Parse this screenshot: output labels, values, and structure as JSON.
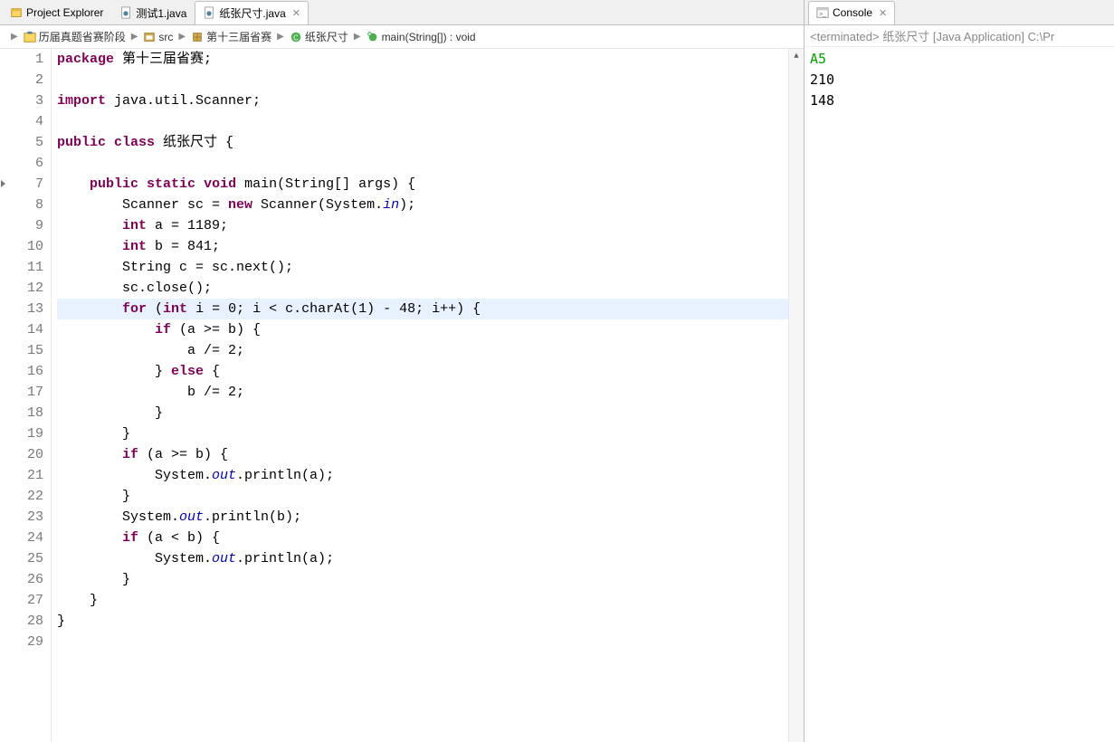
{
  "tabs": {
    "project_explorer": "Project Explorer",
    "file1": "测试1.java",
    "file2": "纸张尺寸.java"
  },
  "breadcrumb": {
    "item1": "历届真题省赛阶段",
    "item2": "src",
    "item3": "第十三届省赛",
    "item4": "纸张尺寸",
    "item5": "main(String[]) : void"
  },
  "code": {
    "lines": [
      {
        "n": "1",
        "seg": [
          {
            "t": "package",
            "c": "kw"
          },
          {
            "t": " 第十三届省赛;",
            "c": "plain"
          }
        ]
      },
      {
        "n": "2",
        "seg": []
      },
      {
        "n": "3",
        "seg": [
          {
            "t": "import",
            "c": "kw"
          },
          {
            "t": " java.util.Scanner;",
            "c": "plain"
          }
        ]
      },
      {
        "n": "4",
        "seg": []
      },
      {
        "n": "5",
        "seg": [
          {
            "t": "public",
            "c": "kw"
          },
          {
            "t": " ",
            "c": "plain"
          },
          {
            "t": "class",
            "c": "kw"
          },
          {
            "t": " 纸张尺寸 {",
            "c": "plain"
          }
        ]
      },
      {
        "n": "6",
        "seg": []
      },
      {
        "n": "7",
        "seg": [
          {
            "t": "    ",
            "c": "plain"
          },
          {
            "t": "public",
            "c": "kw"
          },
          {
            "t": " ",
            "c": "plain"
          },
          {
            "t": "static",
            "c": "kw"
          },
          {
            "t": " ",
            "c": "plain"
          },
          {
            "t": "void",
            "c": "kw"
          },
          {
            "t": " main(String[] args) {",
            "c": "plain"
          }
        ]
      },
      {
        "n": "8",
        "seg": [
          {
            "t": "        Scanner sc = ",
            "c": "plain"
          },
          {
            "t": "new",
            "c": "kw"
          },
          {
            "t": " Scanner(System.",
            "c": "plain"
          },
          {
            "t": "in",
            "c": "italic-static"
          },
          {
            "t": ");",
            "c": "plain"
          }
        ]
      },
      {
        "n": "9",
        "seg": [
          {
            "t": "        ",
            "c": "plain"
          },
          {
            "t": "int",
            "c": "kw"
          },
          {
            "t": " a = 1189;",
            "c": "plain"
          }
        ]
      },
      {
        "n": "10",
        "seg": [
          {
            "t": "        ",
            "c": "plain"
          },
          {
            "t": "int",
            "c": "kw"
          },
          {
            "t": " b = 841;",
            "c": "plain"
          }
        ]
      },
      {
        "n": "11",
        "seg": [
          {
            "t": "        String c = sc.next();",
            "c": "plain"
          }
        ]
      },
      {
        "n": "12",
        "seg": [
          {
            "t": "        sc.close();",
            "c": "plain"
          }
        ]
      },
      {
        "n": "13",
        "hl": true,
        "seg": [
          {
            "t": "        ",
            "c": "plain"
          },
          {
            "t": "for",
            "c": "kw"
          },
          {
            "t": " (",
            "c": "plain"
          },
          {
            "t": "int",
            "c": "kw"
          },
          {
            "t": " i = 0; i < c.charAt(1) - 48; i++) {",
            "c": "plain"
          }
        ]
      },
      {
        "n": "14",
        "seg": [
          {
            "t": "            ",
            "c": "plain"
          },
          {
            "t": "if",
            "c": "kw"
          },
          {
            "t": " (a >= b) {",
            "c": "plain"
          }
        ]
      },
      {
        "n": "15",
        "seg": [
          {
            "t": "                a /= 2;",
            "c": "plain"
          }
        ]
      },
      {
        "n": "16",
        "seg": [
          {
            "t": "            } ",
            "c": "plain"
          },
          {
            "t": "else",
            "c": "kw"
          },
          {
            "t": " {",
            "c": "plain"
          }
        ]
      },
      {
        "n": "17",
        "seg": [
          {
            "t": "                b /= 2;",
            "c": "plain"
          }
        ]
      },
      {
        "n": "18",
        "seg": [
          {
            "t": "            }",
            "c": "plain"
          }
        ]
      },
      {
        "n": "19",
        "seg": [
          {
            "t": "        }",
            "c": "plain"
          }
        ]
      },
      {
        "n": "20",
        "seg": [
          {
            "t": "        ",
            "c": "plain"
          },
          {
            "t": "if",
            "c": "kw"
          },
          {
            "t": " (a >= b) {",
            "c": "plain"
          }
        ]
      },
      {
        "n": "21",
        "seg": [
          {
            "t": "            System.",
            "c": "plain"
          },
          {
            "t": "out",
            "c": "italic-static"
          },
          {
            "t": ".println(a);",
            "c": "plain"
          }
        ]
      },
      {
        "n": "22",
        "seg": [
          {
            "t": "        }",
            "c": "plain"
          }
        ]
      },
      {
        "n": "23",
        "seg": [
          {
            "t": "        System.",
            "c": "plain"
          },
          {
            "t": "out",
            "c": "italic-static"
          },
          {
            "t": ".println(b);",
            "c": "plain"
          }
        ]
      },
      {
        "n": "24",
        "seg": [
          {
            "t": "        ",
            "c": "plain"
          },
          {
            "t": "if",
            "c": "kw"
          },
          {
            "t": " (a < b) {",
            "c": "plain"
          }
        ]
      },
      {
        "n": "25",
        "seg": [
          {
            "t": "            System.",
            "c": "plain"
          },
          {
            "t": "out",
            "c": "italic-static"
          },
          {
            "t": ".println(a);",
            "c": "plain"
          }
        ]
      },
      {
        "n": "26",
        "seg": [
          {
            "t": "        }",
            "c": "plain"
          }
        ]
      },
      {
        "n": "27",
        "seg": [
          {
            "t": "    }",
            "c": "plain"
          }
        ]
      },
      {
        "n": "28",
        "seg": [
          {
            "t": "}",
            "c": "plain"
          }
        ]
      },
      {
        "n": "29",
        "seg": []
      }
    ]
  },
  "console": {
    "title": "Console",
    "status": "<terminated> 纸张尺寸 [Java Application] C:\\Pr",
    "lines": [
      {
        "text": "A5",
        "cls": "inp"
      },
      {
        "text": "210",
        "cls": "outp"
      },
      {
        "text": "148",
        "cls": "outp"
      }
    ]
  }
}
